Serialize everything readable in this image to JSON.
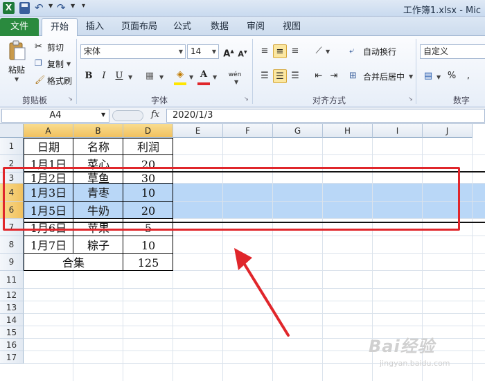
{
  "titlebar": {
    "window_title": "工作簿1.xlsx - Mic"
  },
  "tabs": {
    "file": "文件",
    "items": [
      "开始",
      "插入",
      "页面布局",
      "公式",
      "数据",
      "审阅",
      "视图"
    ],
    "active": "开始"
  },
  "ribbon": {
    "clipboard": {
      "paste": "粘贴",
      "cut": "剪切",
      "copy": "复制",
      "format_painter": "格式刷",
      "group_label": "剪贴板"
    },
    "font": {
      "font_name": "宋体",
      "font_size": "14",
      "bold": "B",
      "italic": "I",
      "underline": "U",
      "font_color_glyph": "A",
      "wen": "wén",
      "group_label": "字体"
    },
    "alignment": {
      "wrap_text": "自动换行",
      "merge_center": "合并后居中",
      "group_label": "对齐方式"
    },
    "number": {
      "format": "自定义",
      "percent": "%",
      "comma": ",",
      "group_label": "数字"
    }
  },
  "formula_bar": {
    "name_box": "A4",
    "fx": "fx",
    "formula": "2020/1/3"
  },
  "columns": [
    "A",
    "B",
    "D",
    "E",
    "F",
    "G",
    "H",
    "I",
    "J"
  ],
  "rows": [
    "1",
    "2",
    "3",
    "4",
    "6",
    "7",
    "8",
    "9",
    "11",
    "12",
    "13",
    "14",
    "15",
    "16",
    "17"
  ],
  "selected_rows": [
    "4",
    "6"
  ],
  "table": {
    "header": [
      "日期",
      "名称",
      "利润"
    ],
    "rows": [
      [
        "1月1日",
        "菜心",
        "20"
      ],
      [
        "1月2日",
        "草鱼",
        "30"
      ],
      [
        "1月3日",
        "青枣",
        "10"
      ],
      [
        "1月5日",
        "牛奶",
        "20"
      ],
      [
        "1月6日",
        "苹果",
        "5"
      ],
      [
        "1月7日",
        "粽子",
        "10"
      ]
    ],
    "total_label": "合集",
    "total_value": "125"
  },
  "watermark": {
    "brand": "Bai经验",
    "url": "jingyan.baidu.com"
  },
  "colors": {
    "accent_green": "#2a8a3e",
    "selection_blue": "#b9d7f7",
    "header_highlight": "#f1c15f",
    "annotation_red": "#e0262b"
  }
}
